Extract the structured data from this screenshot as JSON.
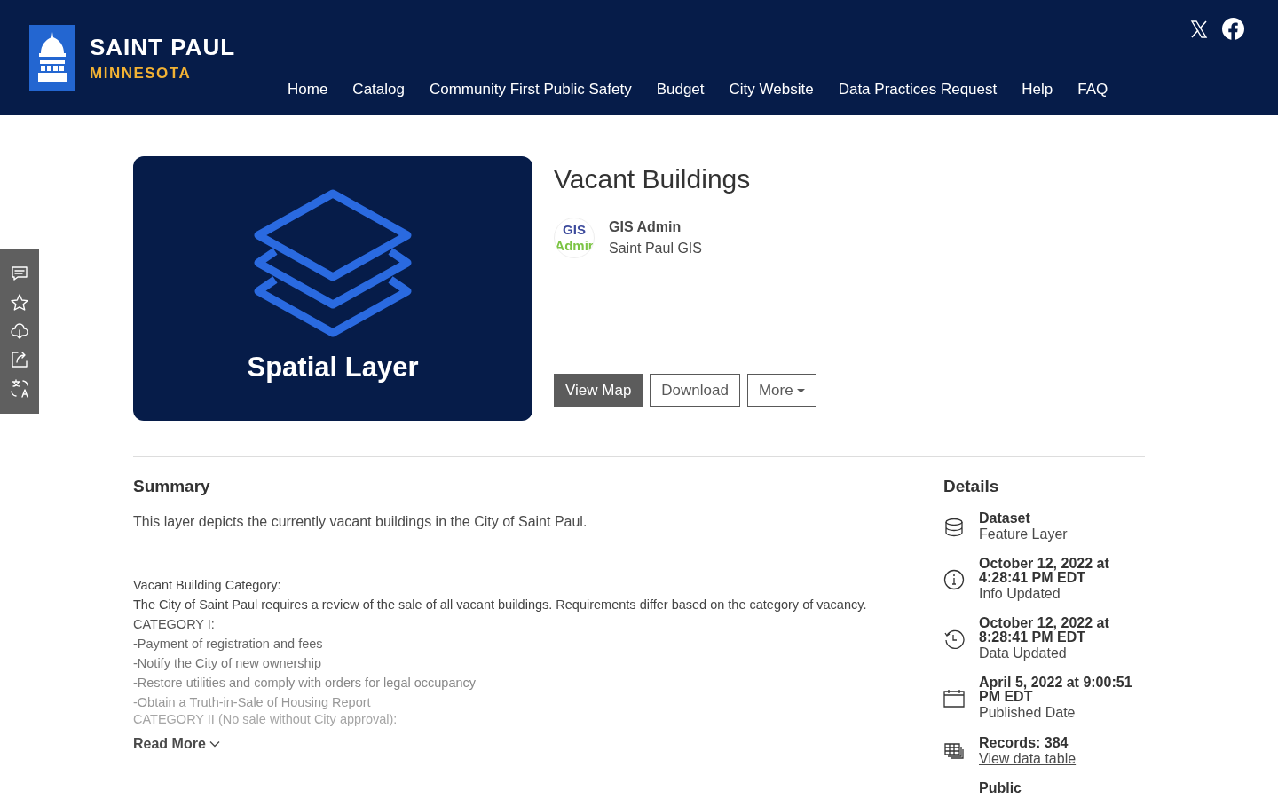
{
  "header": {
    "logo": {
      "line1": "SAINT PAUL",
      "line2": "MINNESOTA"
    },
    "nav": [
      {
        "label": "Home"
      },
      {
        "label": "Catalog"
      },
      {
        "label": "Community First Public Safety"
      },
      {
        "label": "Budget"
      },
      {
        "label": "City Website"
      },
      {
        "label": "Data Practices Request"
      },
      {
        "label": "Help"
      },
      {
        "label": "FAQ"
      }
    ],
    "social": [
      {
        "kind": "x"
      },
      {
        "kind": "facebook"
      }
    ]
  },
  "side_toolbar": [
    {
      "kind": "comment"
    },
    {
      "kind": "star"
    },
    {
      "kind": "download"
    },
    {
      "kind": "share"
    },
    {
      "kind": "translate"
    }
  ],
  "thumbnail": {
    "caption": "Spatial Layer"
  },
  "title": "Vacant Buildings",
  "owner": {
    "avatar": {
      "line1": "GIS",
      "line2": "Admir"
    },
    "name": "GIS Admin",
    "org": "Saint Paul GIS"
  },
  "actions": [
    {
      "label": "View Map",
      "kind": "primary"
    },
    {
      "label": "Download",
      "kind": "outline"
    },
    {
      "label": "More",
      "kind": "dropdown"
    }
  ],
  "summary": {
    "heading": "Summary",
    "text": "This layer depicts the currently vacant buildings in the City of Saint Paul.",
    "description": [
      "Vacant Building Category:",
      "The City of Saint Paul requires a review of the sale of all vacant buildings. Requirements differ based on the category of vacancy.",
      "CATEGORY I:",
      "-Payment of registration and fees",
      "-Notify the City of new ownership",
      "-Restore utilities and comply with orders for legal occupancy",
      "-Obtain a Truth-in-Sale of Housing Report",
      "CATEGORY II (No sale without City approval):"
    ],
    "read_more": "Read More"
  },
  "details": {
    "heading": "Details",
    "items": [
      {
        "kind": "dataset",
        "title": "Dataset",
        "subtitle": "Feature Layer"
      },
      {
        "kind": "info",
        "title": "October 12, 2022 at 4:28:41 PM EDT",
        "subtitle": "Info Updated"
      },
      {
        "kind": "history",
        "title": "October 12, 2022 at 8:28:41 PM EDT",
        "subtitle": "Data Updated"
      },
      {
        "kind": "calendar",
        "title": "April 5, 2022 at 9:00:51 PM EDT",
        "subtitle": "Published Date"
      },
      {
        "kind": "table",
        "title": "Records: 384",
        "link": "View data table"
      },
      {
        "kind": "public",
        "title": "Public"
      }
    ]
  }
}
